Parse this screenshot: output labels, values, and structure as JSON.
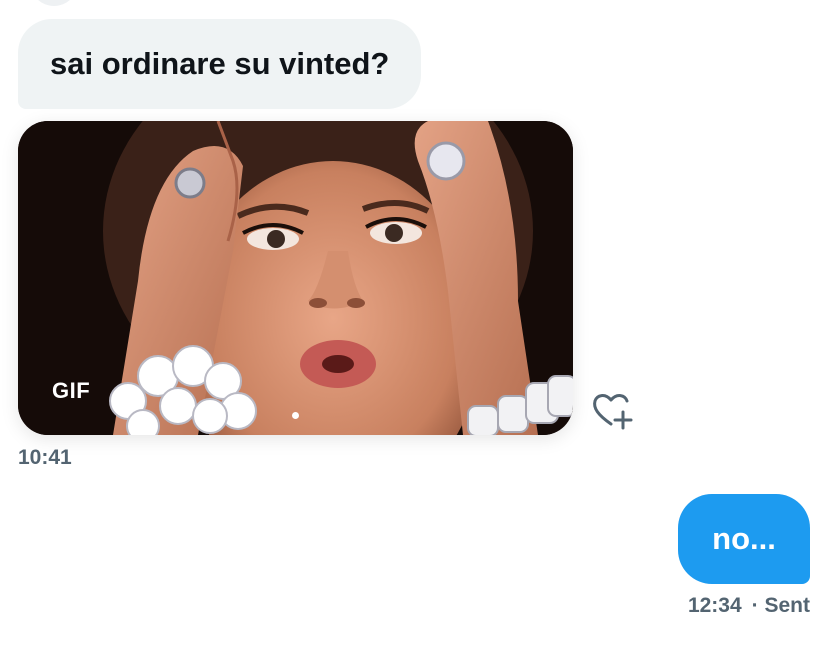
{
  "received": {
    "message_text": "sai ordinare su vinted?",
    "gif_badge": "GIF",
    "timestamp": "10:41"
  },
  "sent": {
    "message_text": "no...",
    "timestamp": "12:34",
    "status": "· Sent"
  },
  "icons": {
    "reaction": "heart-plus-icon"
  },
  "colors": {
    "sent_bubble": "#1d9bf0",
    "received_bubble": "#eff3f4",
    "meta_text": "#536471",
    "text": "#0f1419"
  }
}
